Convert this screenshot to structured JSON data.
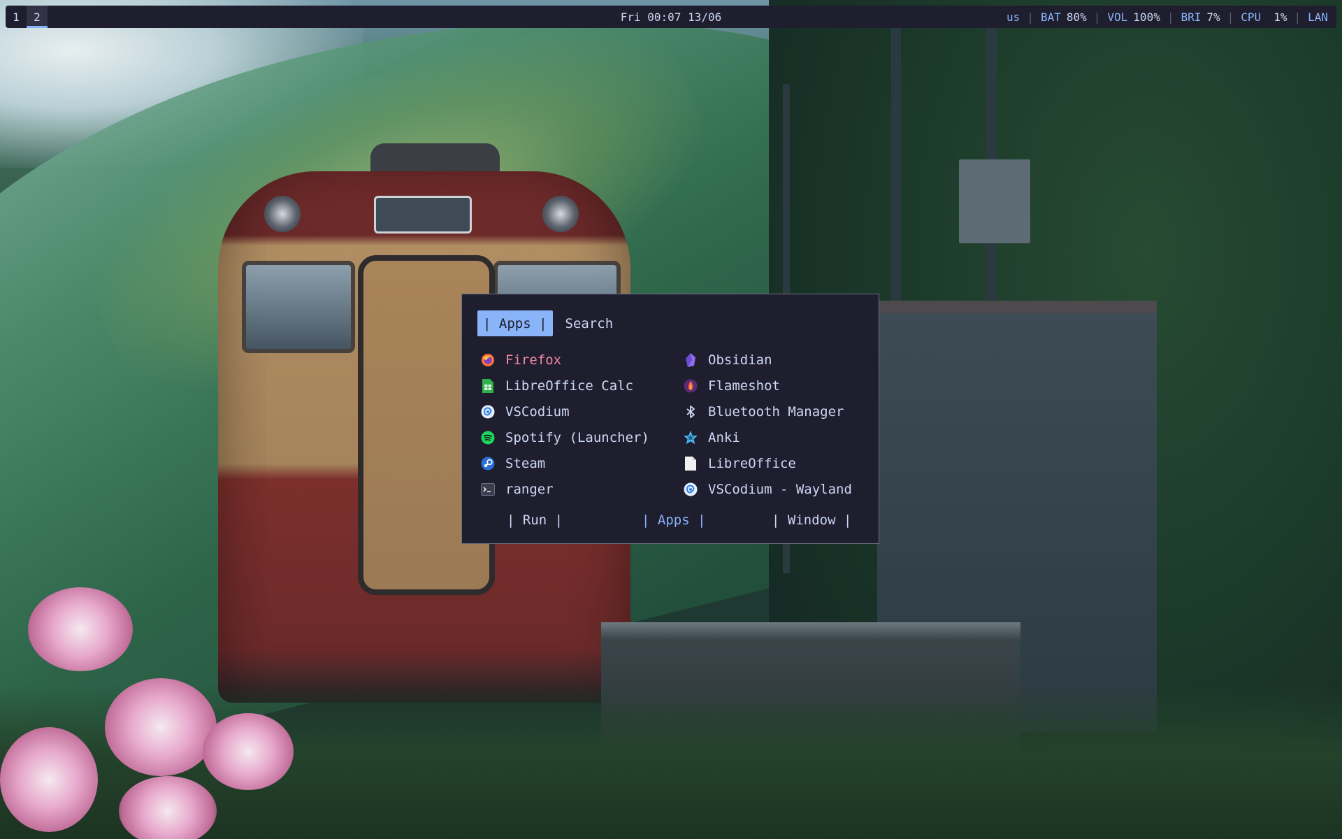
{
  "statusbar": {
    "workspaces": [
      {
        "label": "1",
        "active": false
      },
      {
        "label": "2",
        "active": true
      }
    ],
    "clock": "Fri 00:07 13/06",
    "keyboard_layout": "us",
    "battery": {
      "label": "BAT",
      "value": "80%"
    },
    "volume": {
      "label": "VOL",
      "value": "100%"
    },
    "brightness": {
      "label": "BRI",
      "value": "7%"
    },
    "cpu": {
      "label": "CPU",
      "value": "1%"
    },
    "network": "LAN",
    "separator": "|"
  },
  "launcher": {
    "tabs": {
      "active": "| Apps |",
      "other": "Search"
    },
    "apps_left": [
      {
        "label": "Firefox",
        "icon": "firefox-icon",
        "selected": true
      },
      {
        "label": "LibreOffice Calc",
        "icon": "libreoffice-calc-icon"
      },
      {
        "label": "VSCodium",
        "icon": "vscodium-icon"
      },
      {
        "label": "Spotify (Launcher)",
        "icon": "spotify-icon"
      },
      {
        "label": "Steam",
        "icon": "steam-icon"
      },
      {
        "label": "ranger",
        "icon": "terminal-icon"
      }
    ],
    "apps_right": [
      {
        "label": "Obsidian",
        "icon": "obsidian-icon"
      },
      {
        "label": "Flameshot",
        "icon": "flameshot-icon"
      },
      {
        "label": "Bluetooth Manager",
        "icon": "bluetooth-icon"
      },
      {
        "label": "Anki",
        "icon": "anki-icon"
      },
      {
        "label": "LibreOffice",
        "icon": "libreoffice-icon"
      },
      {
        "label": "VSCodium - Wayland",
        "icon": "vscodium-wayland-icon"
      }
    ],
    "modes": [
      {
        "label": "| Run |",
        "active": false
      },
      {
        "label": "| Apps |",
        "active": true
      },
      {
        "label": "| Window |",
        "active": false
      }
    ]
  },
  "colors": {
    "bar_bg": "#1e1e2e",
    "accent": "#89b4fa",
    "selected_text": "#f38ba8",
    "text": "#cdd6f4"
  }
}
